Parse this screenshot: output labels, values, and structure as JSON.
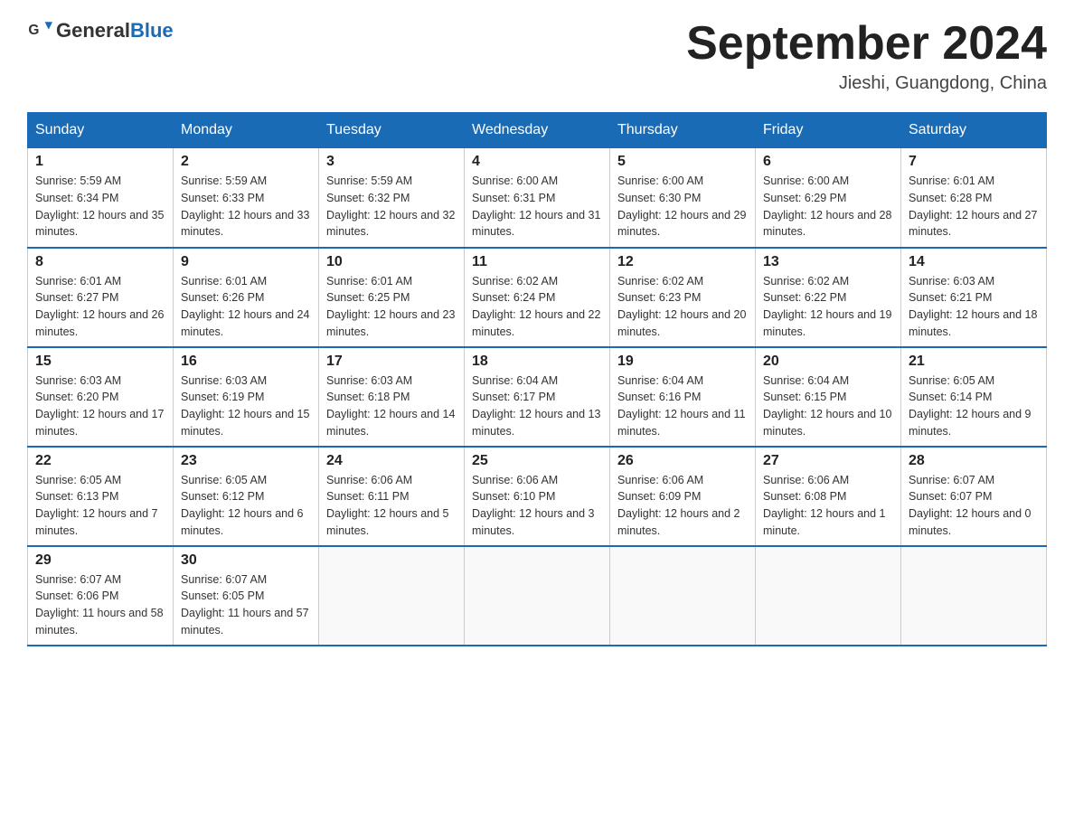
{
  "header": {
    "logo_general": "General",
    "logo_blue": "Blue",
    "title": "September 2024",
    "subtitle": "Jieshi, Guangdong, China"
  },
  "columns": [
    "Sunday",
    "Monday",
    "Tuesday",
    "Wednesday",
    "Thursday",
    "Friday",
    "Saturday"
  ],
  "weeks": [
    [
      {
        "day": "1",
        "sunrise": "Sunrise: 5:59 AM",
        "sunset": "Sunset: 6:34 PM",
        "daylight": "Daylight: 12 hours and 35 minutes."
      },
      {
        "day": "2",
        "sunrise": "Sunrise: 5:59 AM",
        "sunset": "Sunset: 6:33 PM",
        "daylight": "Daylight: 12 hours and 33 minutes."
      },
      {
        "day": "3",
        "sunrise": "Sunrise: 5:59 AM",
        "sunset": "Sunset: 6:32 PM",
        "daylight": "Daylight: 12 hours and 32 minutes."
      },
      {
        "day": "4",
        "sunrise": "Sunrise: 6:00 AM",
        "sunset": "Sunset: 6:31 PM",
        "daylight": "Daylight: 12 hours and 31 minutes."
      },
      {
        "day": "5",
        "sunrise": "Sunrise: 6:00 AM",
        "sunset": "Sunset: 6:30 PM",
        "daylight": "Daylight: 12 hours and 29 minutes."
      },
      {
        "day": "6",
        "sunrise": "Sunrise: 6:00 AM",
        "sunset": "Sunset: 6:29 PM",
        "daylight": "Daylight: 12 hours and 28 minutes."
      },
      {
        "day": "7",
        "sunrise": "Sunrise: 6:01 AM",
        "sunset": "Sunset: 6:28 PM",
        "daylight": "Daylight: 12 hours and 27 minutes."
      }
    ],
    [
      {
        "day": "8",
        "sunrise": "Sunrise: 6:01 AM",
        "sunset": "Sunset: 6:27 PM",
        "daylight": "Daylight: 12 hours and 26 minutes."
      },
      {
        "day": "9",
        "sunrise": "Sunrise: 6:01 AM",
        "sunset": "Sunset: 6:26 PM",
        "daylight": "Daylight: 12 hours and 24 minutes."
      },
      {
        "day": "10",
        "sunrise": "Sunrise: 6:01 AM",
        "sunset": "Sunset: 6:25 PM",
        "daylight": "Daylight: 12 hours and 23 minutes."
      },
      {
        "day": "11",
        "sunrise": "Sunrise: 6:02 AM",
        "sunset": "Sunset: 6:24 PM",
        "daylight": "Daylight: 12 hours and 22 minutes."
      },
      {
        "day": "12",
        "sunrise": "Sunrise: 6:02 AM",
        "sunset": "Sunset: 6:23 PM",
        "daylight": "Daylight: 12 hours and 20 minutes."
      },
      {
        "day": "13",
        "sunrise": "Sunrise: 6:02 AM",
        "sunset": "Sunset: 6:22 PM",
        "daylight": "Daylight: 12 hours and 19 minutes."
      },
      {
        "day": "14",
        "sunrise": "Sunrise: 6:03 AM",
        "sunset": "Sunset: 6:21 PM",
        "daylight": "Daylight: 12 hours and 18 minutes."
      }
    ],
    [
      {
        "day": "15",
        "sunrise": "Sunrise: 6:03 AM",
        "sunset": "Sunset: 6:20 PM",
        "daylight": "Daylight: 12 hours and 17 minutes."
      },
      {
        "day": "16",
        "sunrise": "Sunrise: 6:03 AM",
        "sunset": "Sunset: 6:19 PM",
        "daylight": "Daylight: 12 hours and 15 minutes."
      },
      {
        "day": "17",
        "sunrise": "Sunrise: 6:03 AM",
        "sunset": "Sunset: 6:18 PM",
        "daylight": "Daylight: 12 hours and 14 minutes."
      },
      {
        "day": "18",
        "sunrise": "Sunrise: 6:04 AM",
        "sunset": "Sunset: 6:17 PM",
        "daylight": "Daylight: 12 hours and 13 minutes."
      },
      {
        "day": "19",
        "sunrise": "Sunrise: 6:04 AM",
        "sunset": "Sunset: 6:16 PM",
        "daylight": "Daylight: 12 hours and 11 minutes."
      },
      {
        "day": "20",
        "sunrise": "Sunrise: 6:04 AM",
        "sunset": "Sunset: 6:15 PM",
        "daylight": "Daylight: 12 hours and 10 minutes."
      },
      {
        "day": "21",
        "sunrise": "Sunrise: 6:05 AM",
        "sunset": "Sunset: 6:14 PM",
        "daylight": "Daylight: 12 hours and 9 minutes."
      }
    ],
    [
      {
        "day": "22",
        "sunrise": "Sunrise: 6:05 AM",
        "sunset": "Sunset: 6:13 PM",
        "daylight": "Daylight: 12 hours and 7 minutes."
      },
      {
        "day": "23",
        "sunrise": "Sunrise: 6:05 AM",
        "sunset": "Sunset: 6:12 PM",
        "daylight": "Daylight: 12 hours and 6 minutes."
      },
      {
        "day": "24",
        "sunrise": "Sunrise: 6:06 AM",
        "sunset": "Sunset: 6:11 PM",
        "daylight": "Daylight: 12 hours and 5 minutes."
      },
      {
        "day": "25",
        "sunrise": "Sunrise: 6:06 AM",
        "sunset": "Sunset: 6:10 PM",
        "daylight": "Daylight: 12 hours and 3 minutes."
      },
      {
        "day": "26",
        "sunrise": "Sunrise: 6:06 AM",
        "sunset": "Sunset: 6:09 PM",
        "daylight": "Daylight: 12 hours and 2 minutes."
      },
      {
        "day": "27",
        "sunrise": "Sunrise: 6:06 AM",
        "sunset": "Sunset: 6:08 PM",
        "daylight": "Daylight: 12 hours and 1 minute."
      },
      {
        "day": "28",
        "sunrise": "Sunrise: 6:07 AM",
        "sunset": "Sunset: 6:07 PM",
        "daylight": "Daylight: 12 hours and 0 minutes."
      }
    ],
    [
      {
        "day": "29",
        "sunrise": "Sunrise: 6:07 AM",
        "sunset": "Sunset: 6:06 PM",
        "daylight": "Daylight: 11 hours and 58 minutes."
      },
      {
        "day": "30",
        "sunrise": "Sunrise: 6:07 AM",
        "sunset": "Sunset: 6:05 PM",
        "daylight": "Daylight: 11 hours and 57 minutes."
      },
      null,
      null,
      null,
      null,
      null
    ]
  ]
}
